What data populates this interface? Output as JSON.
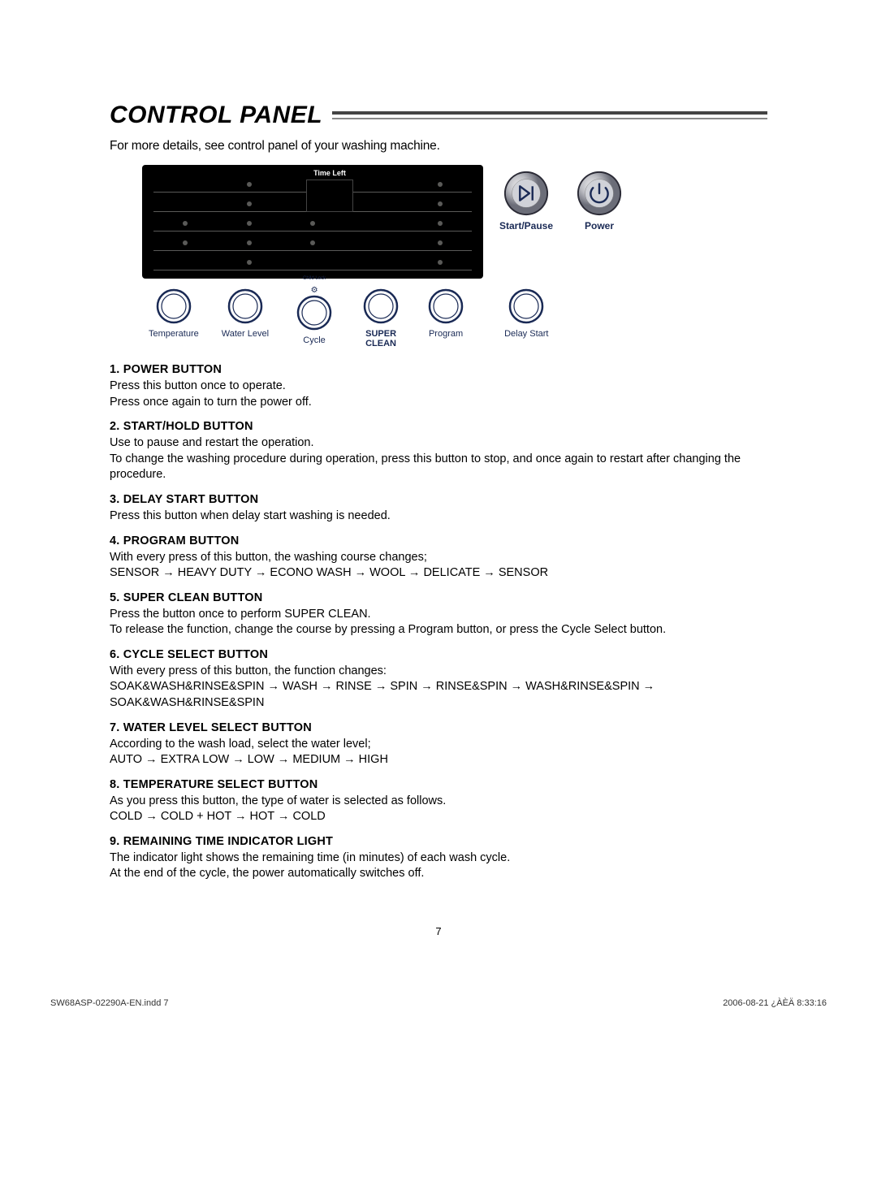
{
  "title": "CONTROL PANEL",
  "intro": "For more details, see control panel of your washing machine.",
  "panel": {
    "time_left_label": "Time Left",
    "start_pause_label": "Start/Pause",
    "power_label": "Power",
    "child_lock_label": "Child Lock",
    "controls": [
      {
        "name": "temperature",
        "label": "Temperature"
      },
      {
        "name": "water-level",
        "label": "Water Level"
      },
      {
        "name": "cycle",
        "label": "Cycle"
      },
      {
        "name": "super-clean",
        "label_line1": "SUPER",
        "label_line2": "CLEAN"
      },
      {
        "name": "program",
        "label": "Program"
      },
      {
        "name": "delay-start",
        "label": "Delay Start"
      }
    ]
  },
  "sections": [
    {
      "heading": "1. POWER BUTTON",
      "body": "Press this button once to operate.\nPress once again to turn the power off."
    },
    {
      "heading": "2. START/HOLD BUTTON",
      "body": "Use to pause and restart the operation.\nTo change the washing procedure during operation, press this button to stop, and once again to restart after changing the procedure."
    },
    {
      "heading": "3. DELAY START BUTTON",
      "body": "Press this button when delay start washing is needed."
    },
    {
      "heading": "4. PROGRAM BUTTON",
      "body": "With every press of this button, the washing course changes;\nSENSOR → HEAVY DUTY → ECONO WASH → WOOL → DELICATE → SENSOR"
    },
    {
      "heading": "5. SUPER CLEAN BUTTON",
      "body": "Press the button once to perform SUPER CLEAN.\nTo release the function, change the course by pressing a Program button, or press the Cycle Select button."
    },
    {
      "heading": "6. CYCLE SELECT BUTTON",
      "body": "With every press of this button, the function changes:\nSOAK&WASH&RINSE&SPIN → WASH → RINSE → SPIN → RINSE&SPIN → WASH&RINSE&SPIN → SOAK&WASH&RINSE&SPIN"
    },
    {
      "heading": "7. WATER LEVEL SELECT BUTTON",
      "body": "According to the wash load, select the water level;\nAUTO → EXTRA LOW → LOW → MEDIUM → HIGH"
    },
    {
      "heading": "8. TEMPERATURE SELECT BUTTON",
      "body": "As you press this button, the type of water is selected as follows.\nCOLD → COLD + HOT → HOT → COLD"
    },
    {
      "heading": "9. REMAINING TIME INDICATOR LIGHT",
      "body": "The indicator light shows the remaining time (in minutes) of each wash cycle.\nAt the end of the cycle, the power automatically switches off."
    }
  ],
  "page_number": "7",
  "footer_left": "SW68ASP-02290A-EN.indd   7",
  "footer_right": "2006-08-21   ¿ÀÈÄ 8:33:16"
}
